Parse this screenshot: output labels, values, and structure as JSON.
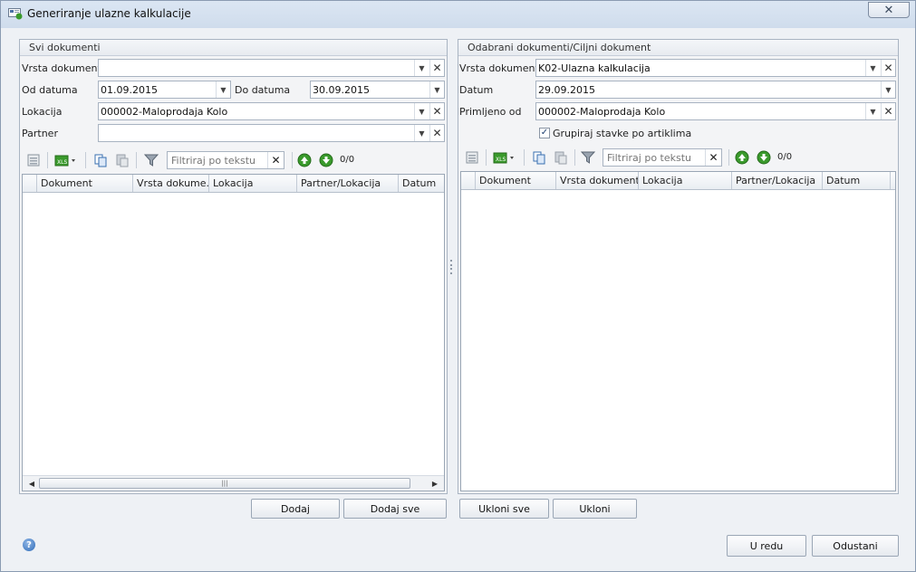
{
  "window": {
    "title": "Generiranje ulazne kalkulacije",
    "close_glyph": "✕"
  },
  "left_panel": {
    "header": "Svi dokumenti",
    "vrsta_dokumenta": {
      "label": "Vrsta dokumenta",
      "value": ""
    },
    "od_datuma": {
      "label": "Od datuma",
      "value": "01.09.2015"
    },
    "do_datuma": {
      "label": "Do datuma",
      "value": "30.09.2015"
    },
    "lokacija": {
      "label": "Lokacija",
      "value": "000002-Maloprodaja Kolo"
    },
    "partner": {
      "label": "Partner",
      "value": ""
    },
    "filter_placeholder": "Filtriraj po tekstu",
    "count": "0/0",
    "columns": [
      "Dokument",
      "Vrsta dokume...",
      "Lokacija",
      "Partner/Lokacija",
      "Datum"
    ],
    "scroll_thumb": "|||"
  },
  "right_panel": {
    "header": "Odabrani dokumenti/Ciljni dokument",
    "vrsta_dokumenta": {
      "label": "Vrsta dokumenta",
      "value": "K02-Ulazna kalkulacija"
    },
    "datum": {
      "label": "Datum",
      "value": "29.09.2015"
    },
    "primljeno_od": {
      "label": "Primljeno od",
      "value": "000002-Maloprodaja Kolo"
    },
    "grupiraj": {
      "label": "Grupiraj stavke po artiklima",
      "checked": true
    },
    "filter_placeholder": "Filtriraj po tekstu",
    "count": "0/0",
    "columns": [
      "Dokument",
      "Vrsta dokumenta",
      "Lokacija",
      "Partner/Lokacija",
      "Datum"
    ]
  },
  "buttons": {
    "dodaj": "Dodaj",
    "dodaj_sve": "Dodaj sve",
    "ukloni_sve": "Ukloni sve",
    "ukloni": "Ukloni",
    "u_redu": "U redu",
    "odustani": "Odustani"
  },
  "glyphs": {
    "dropdown": "▼",
    "clear": "✕",
    "scroll_left": "◀",
    "scroll_right": "▶",
    "check": "✓",
    "help": "?"
  },
  "colors": {
    "accent_green": "#3a9a2c",
    "icon_blue": "#2f6cb8"
  },
  "icons": [
    "form-icon",
    "excel-export-icon",
    "copy-icon",
    "paste-icon",
    "funnel-icon",
    "arrow-up-icon",
    "arrow-down-icon",
    "help-icon"
  ]
}
